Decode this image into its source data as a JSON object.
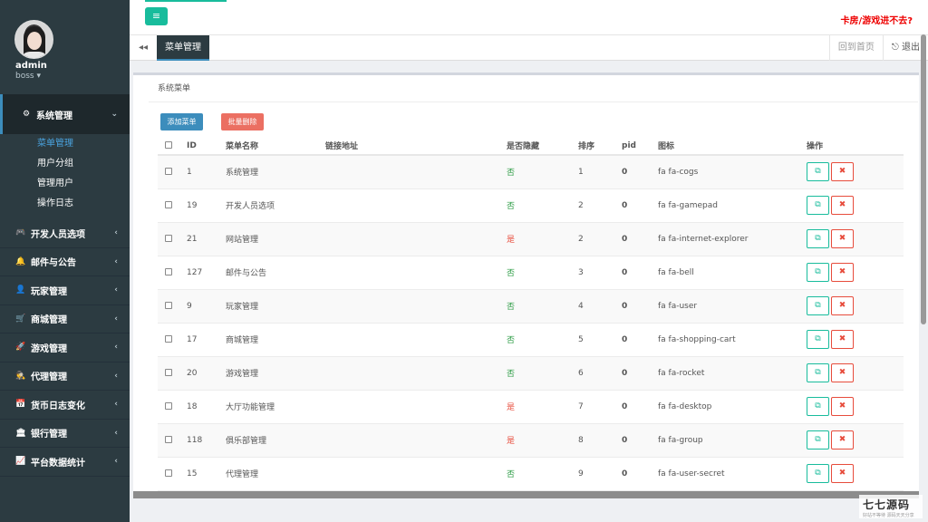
{
  "user": {
    "name": "admin",
    "role": "boss ▾"
  },
  "sidebar": {
    "section": {
      "icon": "⚙",
      "label": "系统管理",
      "chevron": "⌄"
    },
    "sub": [
      "菜单管理",
      "用户分组",
      "管理用户",
      "操作日志"
    ],
    "items": [
      {
        "icon": "🎮",
        "label": "开发人员选项"
      },
      {
        "icon": "🔔",
        "label": "邮件与公告"
      },
      {
        "icon": "👤",
        "label": "玩家管理"
      },
      {
        "icon": "🛒",
        "label": "商城管理"
      },
      {
        "icon": "🚀",
        "label": "游戏管理"
      },
      {
        "icon": "🕵",
        "label": "代理管理"
      },
      {
        "icon": "📅",
        "label": "货币日志变化"
      },
      {
        "icon": "🏛",
        "label": "银行管理"
      },
      {
        "icon": "📈",
        "label": "平台数据统计"
      }
    ],
    "chev": "‹"
  },
  "topbar": {
    "toggle": "≡",
    "warning": "卡房/游戏进不去?"
  },
  "tabbar": {
    "back": "◂◂",
    "active": "菜单管理",
    "home": "回到首页",
    "exit": "⎋ 退出"
  },
  "panel": {
    "title": "系统菜单",
    "add": "添加菜单",
    "batch_delete": "批量删除"
  },
  "table": {
    "headers": [
      "",
      "ID",
      "菜单名称",
      "链接地址",
      "是否隐藏",
      "排序",
      "pid",
      "图标",
      "操作"
    ],
    "rows": [
      {
        "id": "1",
        "name": "系统管理",
        "link": "",
        "hidden": "否",
        "sort": "1",
        "pid": "0",
        "icon": "fa fa-cogs"
      },
      {
        "id": "19",
        "name": "开发人员选项",
        "link": "",
        "hidden": "否",
        "sort": "2",
        "pid": "0",
        "icon": "fa fa-gamepad"
      },
      {
        "id": "21",
        "name": "网站管理",
        "link": "",
        "hidden": "是",
        "sort": "2",
        "pid": "0",
        "icon": "fa fa-internet-explorer"
      },
      {
        "id": "127",
        "name": "邮件与公告",
        "link": "",
        "hidden": "否",
        "sort": "3",
        "pid": "0",
        "icon": "fa fa-bell"
      },
      {
        "id": "9",
        "name": "玩家管理",
        "link": "",
        "hidden": "否",
        "sort": "4",
        "pid": "0",
        "icon": "fa fa-user"
      },
      {
        "id": "17",
        "name": "商城管理",
        "link": "",
        "hidden": "否",
        "sort": "5",
        "pid": "0",
        "icon": "fa fa-shopping-cart"
      },
      {
        "id": "20",
        "name": "游戏管理",
        "link": "",
        "hidden": "否",
        "sort": "6",
        "pid": "0",
        "icon": "fa fa-rocket"
      },
      {
        "id": "18",
        "name": "大厅功能管理",
        "link": "",
        "hidden": "是",
        "sort": "7",
        "pid": "0",
        "icon": "fa fa-desktop"
      },
      {
        "id": "118",
        "name": "俱乐部管理",
        "link": "",
        "hidden": "是",
        "sort": "8",
        "pid": "0",
        "icon": "fa fa-group"
      },
      {
        "id": "15",
        "name": "代理管理",
        "link": "",
        "hidden": "否",
        "sort": "9",
        "pid": "0",
        "icon": "fa fa-user-secret"
      }
    ],
    "edit_glyph": "⧉",
    "del_glyph": "✖"
  },
  "watermark": {
    "title": "七七源码",
    "sub": "好站不等待 源码天天分享"
  }
}
